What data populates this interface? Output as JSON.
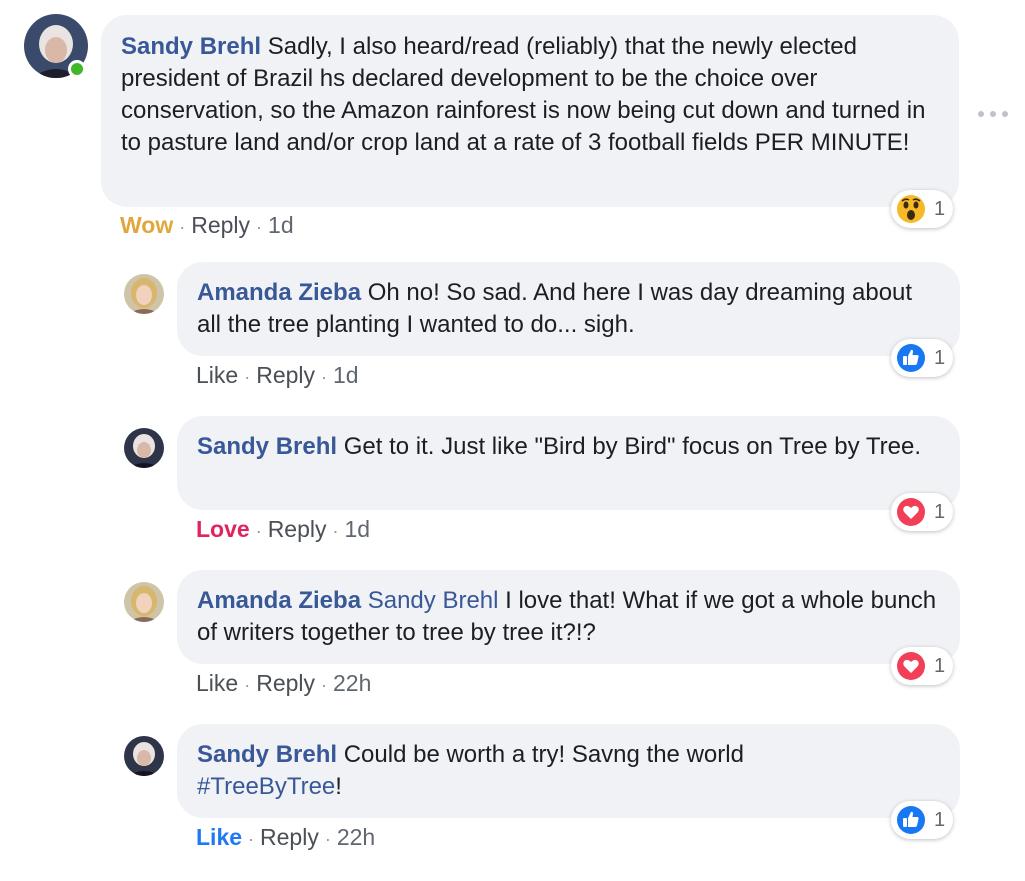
{
  "comments": [
    {
      "author": "Sandy Brehl",
      "text": "Sadly, I also heard/read (reliably) that the newly elected president of Brazil hs declared development to be the choice over conservation, so the Amazon rainforest is now being cut down and turned in to pasture land and/or crop land at a rate of 3 football fields PER MINUTE!",
      "reacted_label": "Wow",
      "reply_label": "Reply",
      "time": "1d",
      "reaction_icon": "wow-emoji-icon",
      "reaction_count": "1"
    }
  ],
  "replies": [
    {
      "author": "Amanda Zieba",
      "text": "Oh no! So sad. And here I was day dreaming about all the tree planting I wanted to do... sigh.",
      "action_label": "Like",
      "reply_label": "Reply",
      "time": "1d",
      "reaction_icon": "like-thumb-icon",
      "reaction_count": "1"
    },
    {
      "author": "Sandy Brehl",
      "text": "Get to it. Just like \"Bird by Bird\" focus on Tree by Tree.",
      "action_label": "Love",
      "reply_label": "Reply",
      "time": "1d",
      "reaction_icon": "love-heart-icon",
      "reaction_count": "1"
    },
    {
      "author": "Amanda Zieba",
      "mention": "Sandy Brehl",
      "text": "I love that! What if we got a whole bunch of writers together to tree by tree it?!?",
      "action_label": "Like",
      "reply_label": "Reply",
      "time": "22h",
      "reaction_icon": "love-heart-icon",
      "reaction_count": "1"
    },
    {
      "author": "Sandy Brehl",
      "text": "Could be worth a try! Savng the world",
      "hashtag": "#TreeByTree",
      "text_after": "!",
      "action_label": "Like",
      "reply_label": "Reply",
      "time": "22h",
      "reaction_icon": "like-thumb-icon",
      "reaction_count": "1"
    }
  ],
  "separator": "·",
  "colors": {
    "author": "#385898",
    "bubble": "#f0f2f5",
    "wow": "#e2a73c",
    "love": "#e0245e",
    "like": "#2078f4",
    "presence": "#42b72a"
  },
  "more_options_icon": "ellipsis-icon"
}
